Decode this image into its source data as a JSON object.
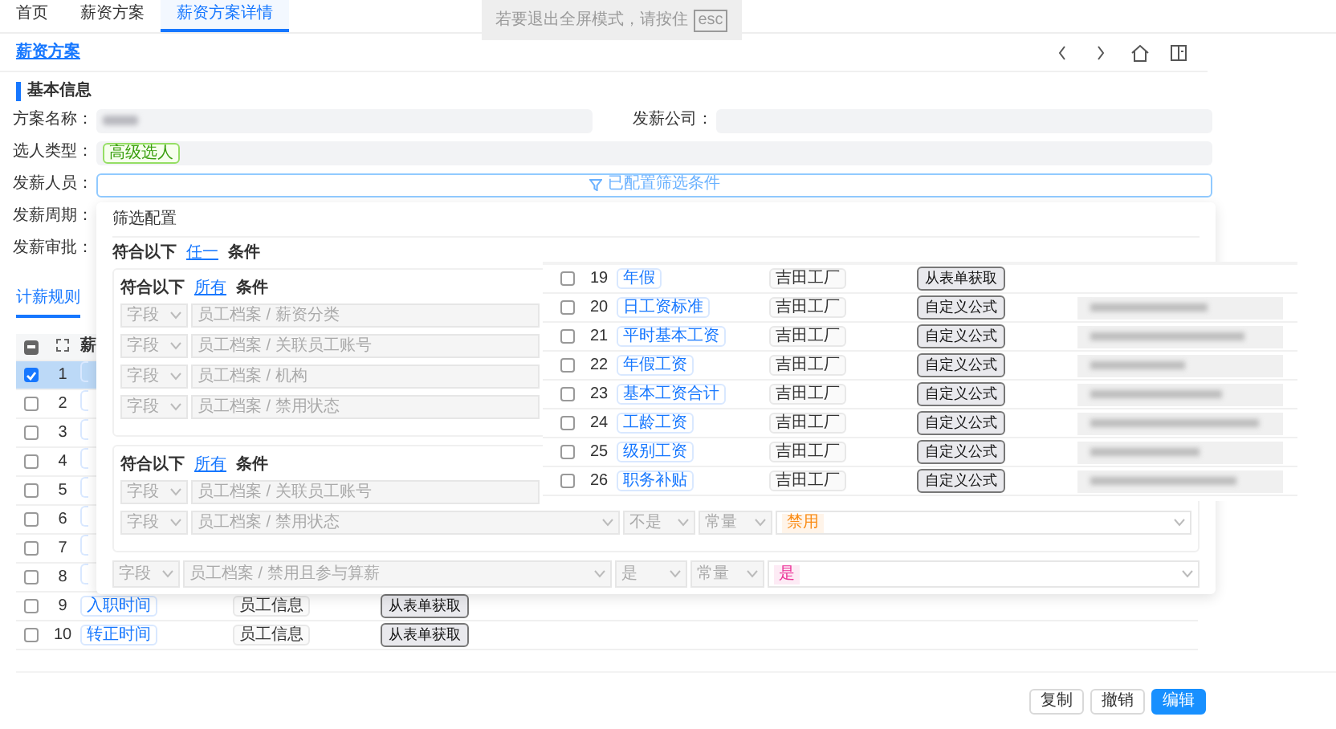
{
  "fullscreen_notice": {
    "text": "若要退出全屏模式，请按住",
    "key": "esc"
  },
  "tabs": [
    {
      "label": "首页",
      "selected": false
    },
    {
      "label": "薪资方案",
      "selected": false
    },
    {
      "label": "薪资方案详情",
      "selected": true
    }
  ],
  "page_title": "薪资方案",
  "section_title": "基本信息",
  "form": {
    "plan_name": {
      "label": "方案名称："
    },
    "company": {
      "label": "发薪公司："
    },
    "selection_type": {
      "label": "选人类型：",
      "tag": "高级选人"
    },
    "payees": {
      "label": "发薪人员：",
      "summary": "已配置筛选条件"
    },
    "cycle": {
      "label": "发薪周期："
    },
    "approval": {
      "label": "发薪审批："
    }
  },
  "rules_tab": {
    "label": "计薪规则",
    "selected": true
  },
  "table": {
    "header_checkbox": {
      "indeterminate": true
    },
    "columns": [
      "薪"
    ],
    "rows": [
      {
        "index": "1",
        "selected": true
      },
      {
        "index": "2",
        "selected": false
      },
      {
        "index": "3",
        "selected": false
      },
      {
        "index": "4",
        "selected": false
      },
      {
        "index": "5",
        "selected": false
      },
      {
        "index": "6",
        "selected": false
      },
      {
        "index": "7",
        "selected": false
      },
      {
        "index": "8",
        "selected": false
      },
      {
        "index": "9",
        "selected": false,
        "name": "入职时间",
        "source": "员工信息",
        "method": "从表单获取"
      },
      {
        "index": "10",
        "selected": false,
        "name": "转正时间",
        "source": "员工信息",
        "method": "从表单获取"
      }
    ]
  },
  "filter_popup": {
    "title": "筛选配置",
    "match": {
      "prefix": "符合以下",
      "mode": "任一",
      "suffix": "条件"
    },
    "groups": [
      {
        "prefix": "符合以下",
        "mode": "所有",
        "suffix": "条件",
        "conditions": [
          {
            "field_type": "字段",
            "path": "员工档案 / 薪资分类"
          },
          {
            "field_type": "字段",
            "path": "员工档案 / 关联员工账号"
          },
          {
            "field_type": "字段",
            "path": "员工档案 / 机构"
          },
          {
            "field_type": "字段",
            "path": "员工档案 / 禁用状态"
          }
        ]
      },
      {
        "prefix": "符合以下",
        "mode": "所有",
        "suffix": "条件",
        "conditions": [
          {
            "field_type": "字段",
            "path": "员工档案 / 关联员工账号"
          },
          {
            "field_type": "字段",
            "path": "员工档案 / 禁用状态",
            "operator": "不是",
            "value_type": "常量",
            "value": "禁用",
            "color": "#fa8c16"
          }
        ]
      }
    ],
    "conditions": [
      {
        "field_type": "字段",
        "path": "员工档案 / 禁用且参与算薪",
        "operator": "是",
        "value_type": "常量",
        "value": "是",
        "color": "#eb2f96"
      }
    ]
  },
  "floating_rows": [
    {
      "index": "19",
      "selected": false,
      "name": "年假",
      "source": "吉田工厂",
      "method": "从表单获取",
      "blurred": false
    },
    {
      "index": "20",
      "selected": false,
      "name": "日工资标准",
      "source": "吉田工厂",
      "method": "自定义公式",
      "blurred": true
    },
    {
      "index": "21",
      "selected": false,
      "name": "平时基本工资",
      "source": "吉田工厂",
      "method": "自定义公式",
      "blurred": true
    },
    {
      "index": "22",
      "selected": false,
      "name": "年假工资",
      "source": "吉田工厂",
      "method": "自定义公式",
      "blurred": true
    },
    {
      "index": "23",
      "selected": false,
      "name": "基本工资合计",
      "source": "吉田工厂",
      "method": "自定义公式",
      "blurred": true
    },
    {
      "index": "24",
      "selected": false,
      "name": "工龄工资",
      "source": "吉田工厂",
      "method": "自定义公式",
      "blurred": true
    },
    {
      "index": "25",
      "selected": false,
      "name": "级别工资",
      "source": "吉田工厂",
      "method": "自定义公式",
      "blurred": true
    },
    {
      "index": "26",
      "selected": false,
      "name": "职务补贴",
      "source": "吉田工厂",
      "method": "自定义公式",
      "blurred": true
    }
  ],
  "footer_buttons": [
    {
      "label": "复制",
      "kind": "default"
    },
    {
      "label": "撤销",
      "kind": "default"
    },
    {
      "label": "编辑",
      "kind": "primary"
    }
  ]
}
